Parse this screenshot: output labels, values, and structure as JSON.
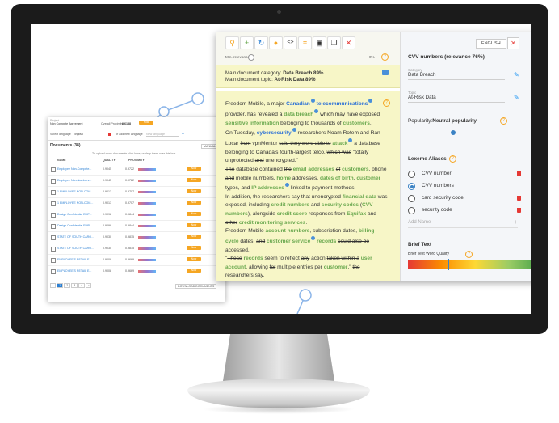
{
  "doc_window": {
    "project_label": "Project",
    "project_value": "Non Compete Agreement",
    "overall_proximity_label": "Overall Proximity:",
    "overall_proximity_value": "0.6138",
    "select_language_label": "Select language",
    "language_value": "English",
    "add_language_label": "or add new language",
    "add_language_placeholder": "New language",
    "documents_title": "Documents (38)",
    "manual_button": "MANUAL TE",
    "upload_hint": "To upload more documents click here, or drop them over this box.",
    "col_name": "NAME",
    "col_quality": "QUALITY",
    "col_proximity": "PROXIMITY",
    "rows": [
      {
        "name": "Employee Non-Compete...",
        "quality": "0.9045",
        "proximity": "0.9722",
        "action": "Now"
      },
      {
        "name": "Employee Non-Numbers...",
        "quality": "0.9045",
        "proximity": "0.9722",
        "action": "Now"
      },
      {
        "name": "1 EMPLOYEE NON-COM...",
        "quality": "0.9013",
        "proximity": "0.9707",
        "action": "Now"
      },
      {
        "name": "1 EMPLOYEE NON-COM...",
        "quality": "0.9013",
        "proximity": "0.9707",
        "action": "Now"
      },
      {
        "name": "Design Confidential EMP...",
        "quality": "0.9098",
        "proximity": "0.9844",
        "action": "Now"
      },
      {
        "name": "Design Confidential EMP...",
        "quality": "0.9098",
        "proximity": "0.9844",
        "action": "Now"
      },
      {
        "name": "STATE OF SOUTH CARO...",
        "quality": "0.9030",
        "proximity": "0.9815",
        "action": "Now"
      },
      {
        "name": "STATE OF SOUTH CARO...",
        "quality": "0.9030",
        "proximity": "0.9815",
        "action": "Now"
      },
      {
        "name": "EMPLOYEE'S RETAIL E...",
        "quality": "0.9008",
        "proximity": "0.9669",
        "action": "Now"
      },
      {
        "name": "EMPLOYEE'S RETAIL E...",
        "quality": "0.9008",
        "proximity": "0.9669",
        "action": "Now"
      }
    ],
    "pages": [
      "1",
      "2",
      "3",
      "4"
    ],
    "download_button": "DOWNLOAD DOCUMENTS"
  },
  "main_panel": {
    "min_relevance_label": "Min. relevance",
    "min_relevance_value": "0%",
    "category_line_label": "Main document category:",
    "category_line_value": "Data Breach 89%",
    "topic_line_label": "Main document topic:",
    "topic_line_value": "At-Risk Data 89%"
  },
  "right_panel": {
    "lang_button": "ENGLISH",
    "close_glyph": "✕",
    "heading": "CVV numbers (relevance 76%)",
    "category_label": "Category",
    "category_value": "Data Breach",
    "topic_label": "Topic",
    "topic_value": "At-Risk Data",
    "popularity_label": "Popularity:",
    "popularity_value": "Neutral popularity",
    "lexeme_title": "Lexeme Aliases",
    "aliases": [
      {
        "label": "CVV number",
        "selected": false,
        "deletable": true
      },
      {
        "label": "CVV numbers",
        "selected": true,
        "deletable": false
      },
      {
        "label": "card security code",
        "selected": false,
        "deletable": true
      },
      {
        "label": "security code",
        "selected": false,
        "deletable": true
      }
    ],
    "add_name_placeholder": "Add Name",
    "add_glyph": "+",
    "brief_text_title": "Brief Text",
    "brief_quality_label": "Brief Text Word Quality"
  },
  "colors": {
    "accent_orange": "#f5a623",
    "link_blue": "#2a6fd6",
    "entity_green": "#6aa84f",
    "panel_yellow": "#f7f6c7",
    "danger_red": "#e53935"
  }
}
